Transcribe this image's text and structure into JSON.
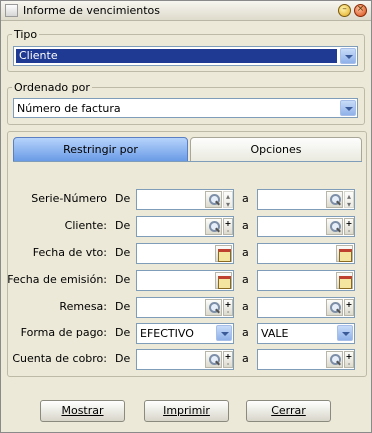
{
  "window": {
    "title": "Informe de vencimientos"
  },
  "tipo": {
    "legend": "Tipo",
    "value": "Cliente"
  },
  "ordenado": {
    "legend": "Ordenado por",
    "value": "Número de factura"
  },
  "tabs": {
    "active": "Restringir por",
    "inactive": "Opciones"
  },
  "words": {
    "de": "De",
    "a": "a"
  },
  "filters": [
    {
      "label": "Serie-Número",
      "from": "",
      "to": "",
      "control": "search"
    },
    {
      "label": "Cliente:",
      "from": "",
      "to": "",
      "control": "search-add"
    },
    {
      "label": "Fecha de vto:",
      "from": "",
      "to": "",
      "control": "calendar"
    },
    {
      "label": "Fecha de emisión:",
      "from": "",
      "to": "",
      "control": "calendar"
    },
    {
      "label": "Remesa:",
      "from": "",
      "to": "",
      "control": "search-add"
    },
    {
      "label": "Forma de pago:",
      "from": "EFECTIVO",
      "to": "VALE",
      "control": "dropdown"
    },
    {
      "label": "Cuenta de cobro:",
      "from": "",
      "to": "",
      "control": "search-add"
    }
  ],
  "buttons": {
    "mostrar": "Mostrar",
    "imprimir": "Imprimir",
    "cerrar": "Cerrar"
  }
}
